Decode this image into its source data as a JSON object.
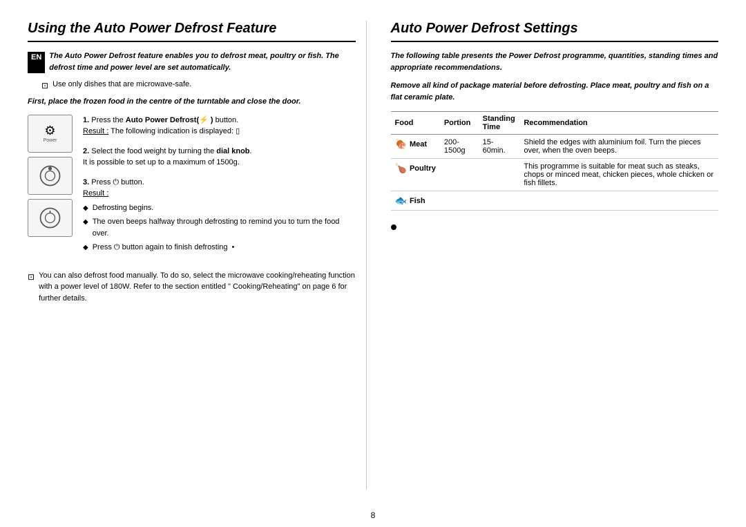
{
  "left": {
    "title": "Using the Auto Power Defrost Feature",
    "en_badge": "EN",
    "intro_text": "The Auto Power Defrost feature enables you to defrost meat, poultry or fish. The defrost time and power level are set automatically.",
    "note1": "Use only dishes that are microwave-safe.",
    "italic_intro": "First, place the frozen food in the centre of the turntable and close the door.",
    "steps": [
      {
        "number": "1.",
        "text": "Press the ",
        "bold_part": "Auto Power Defrost(",
        "symbol": "⚡",
        "end_text": " ) button.",
        "result_label": "Result :",
        "result_text": "The following indication is displayed: ▯"
      },
      {
        "number": "2.",
        "text": "Select the food weight by turning the ",
        "bold_part": "dial knob",
        "end_text": ".\nIt is possible to set up to a maximum of 1500g."
      },
      {
        "number": "3.",
        "text": "Press ⏻ button.",
        "result_label": "Result :",
        "bullets": [
          "Defrosting begins.",
          "The oven beeps halfway through defrosting to remind you to turn the food over.",
          "Press ⏻ button again to finish defrosting"
        ]
      }
    ],
    "bottom_note": "You can also defrost food manually. To do so, select the microwave cooking/reheating function with a power level of 180W. Refer to the section entitled \" Cooking/Reheating\" on page 6 for further details."
  },
  "right": {
    "title": "Auto Power Defrost Settings",
    "intro_text": "The following table presents the Power Defrost programme, quantities, standing times and appropriate recommendations.",
    "remove_text": "Remove all kind of package material before defrosting. Place meat, poultry and fish on a flat ceramic plate.",
    "table": {
      "headers": [
        "Food",
        "Portion",
        "Standing\nTime",
        "Recommendation"
      ],
      "rows": [
        {
          "food": "Meat",
          "food_icon": "🍖",
          "portion": "200-1500g",
          "standing_time": "15-60min.",
          "recommendation": "Shield the edges with aluminium foil. Turn the pieces over, when the oven beeps."
        },
        {
          "food": "Poultry",
          "food_icon": "🍗",
          "portion": "",
          "standing_time": "",
          "recommendation": "This programme is suitable for meat such as steaks, chops or minced meat, chicken pieces, whole chicken or fish fillets."
        },
        {
          "food": "Fish",
          "food_icon": "🐟",
          "portion": "",
          "standing_time": "",
          "recommendation": ""
        }
      ]
    }
  },
  "page_number": "8"
}
